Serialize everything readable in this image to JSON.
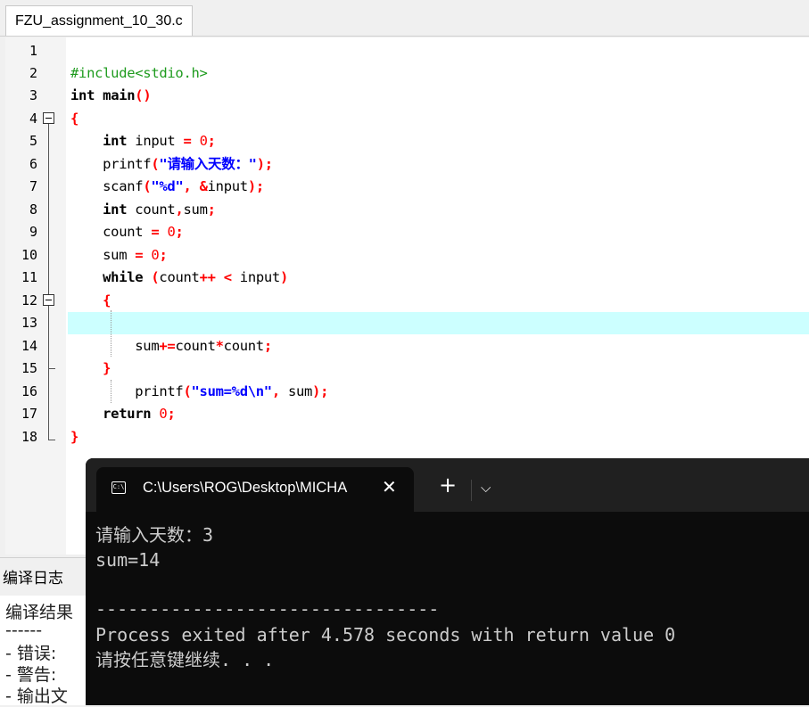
{
  "editor": {
    "tab_title": "FZU_assignment_10_30.c",
    "line_numbers": [
      "1",
      "2",
      "3",
      "4",
      "5",
      "6",
      "7",
      "8",
      "9",
      "10",
      "11",
      "12",
      "13",
      "14",
      "15",
      "16",
      "17",
      "18"
    ],
    "lines": {
      "l2": {
        "pp": "#include<stdio.h>"
      },
      "l3": {
        "kw": "int",
        "sp1": " ",
        "id": "main",
        "sym": "()"
      },
      "l4": {
        "sym": "{"
      },
      "l5": {
        "ind": "    ",
        "kw": "int",
        "sp": " ",
        "id": "input",
        "sp2": " ",
        "op": "=",
        "sp3": " ",
        "num": "0",
        "semi": ";"
      },
      "l6": {
        "ind": "    ",
        "id": "printf",
        "p1": "(",
        "q1": "\"",
        "cjk": "请输入天数：",
        "q2": "\"",
        "p2": ");"
      },
      "l7": {
        "ind": "    ",
        "id": "scanf",
        "p1": "(",
        "str": "\"%d\"",
        "c": ",",
        "sp": " ",
        "amp": "&",
        "id2": "input",
        "p2": ");"
      },
      "l8": {
        "ind": "    ",
        "kw": "int",
        "sp": " ",
        "id": "count",
        "c": ",",
        "id2": "sum",
        "semi": ";"
      },
      "l9": {
        "ind": "    ",
        "id": "count",
        "sp": " ",
        "op": "=",
        "sp2": " ",
        "num": "0",
        "semi": ";"
      },
      "l10": {
        "ind": "    ",
        "id": "sum",
        "sp": " ",
        "op": "=",
        "sp2": " ",
        "num": "0",
        "semi": ";"
      },
      "l11": {
        "ind": "    ",
        "kw": "while",
        "sp": " ",
        "p1": "(",
        "id": "count",
        "op": "++",
        "sp2": " ",
        "op2": "<",
        "sp3": " ",
        "id2": "input",
        "p2": ")"
      },
      "l12": {
        "ind": "    ",
        "sym": "{"
      },
      "l14": {
        "ind": "        ",
        "id": "sum",
        "op": "+=",
        "id2": "count",
        "op2": "*",
        "id3": "count",
        "semi": ";"
      },
      "l15": {
        "ind": "    ",
        "sym": "}"
      },
      "l16": {
        "ind": "        ",
        "id": "printf",
        "p1": "(",
        "str": "\"sum=%d\\n\"",
        "c": ",",
        "sp": " ",
        "id2": "sum",
        "p2": ");"
      },
      "l17": {
        "ind": "    ",
        "kw": "return",
        "sp": " ",
        "num": "0",
        "semi": ";"
      },
      "l18": {
        "sym": "}"
      }
    },
    "active_line": "13"
  },
  "compile_log": {
    "tab_label": "编译日志",
    "lines": [
      "编译结果",
      "------",
      "- 错误:",
      "- 警告:",
      "- 输出文"
    ]
  },
  "terminal": {
    "tab_title": "C:\\Users\\ROG\\Desktop\\MICHA",
    "close_glyph": "✕",
    "new_tab_glyph": "+",
    "dropdown_glyph": "⌵",
    "icon_text": "C:\\",
    "output": [
      "请输入天数：3",
      "sum=14",
      "",
      "--------------------------------",
      "Process exited after 4.578 seconds with return value 0",
      "请按任意键继续. . ."
    ]
  },
  "colors": {
    "preprocessor": "#1e9b1e",
    "string": "#0000ff",
    "symbol": "#ff0000",
    "active_line_bg": "#ccffff",
    "terminal_bg": "#0c0c0c"
  }
}
